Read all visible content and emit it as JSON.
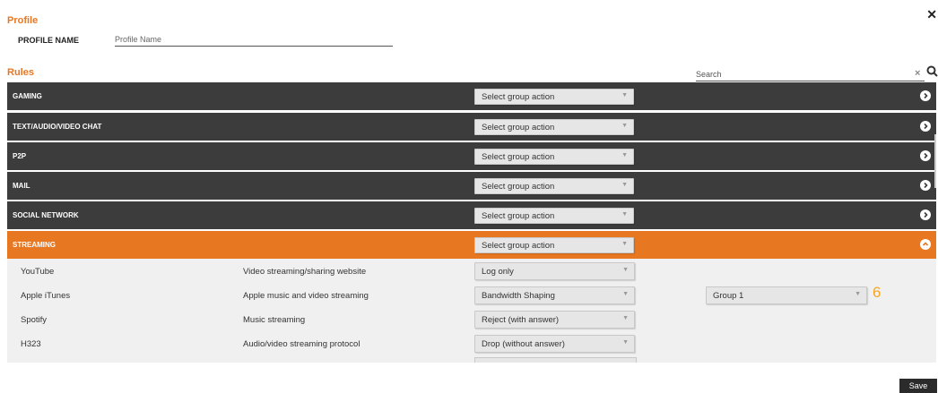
{
  "profile": {
    "title": "Profile",
    "name_label": "PROFILE NAME",
    "name_placeholder": "Profile Name",
    "name_value": ""
  },
  "rules": {
    "title": "Rules",
    "search_placeholder": "Search",
    "search_clear": "×",
    "groups": [
      {
        "name": "GAMING",
        "action": "Select group action",
        "expanded": false
      },
      {
        "name": "TEXT/AUDIO/VIDEO CHAT",
        "action": "Select group action",
        "expanded": false
      },
      {
        "name": "P2P",
        "action": "Select group action",
        "expanded": false
      },
      {
        "name": "MAIL",
        "action": "Select group action",
        "expanded": false
      },
      {
        "name": "SOCIAL NETWORK",
        "action": "Select group action",
        "expanded": false
      },
      {
        "name": "STREAMING",
        "action": "Select group action",
        "expanded": true
      }
    ],
    "apps": [
      {
        "name": "YouTube",
        "description": "Video streaming/sharing website",
        "action": "Log only"
      },
      {
        "name": "Apple iTunes",
        "description": "Apple music and video streaming",
        "action": "Bandwidth Shaping",
        "group": "Group 1",
        "annotation": "6"
      },
      {
        "name": "Spotify",
        "description": "Music streaming",
        "action": "Reject (with answer)"
      },
      {
        "name": "H323",
        "description": "Audio/video streaming protocol",
        "action": "Drop (without answer)"
      }
    ]
  },
  "footer": {
    "save_label": "Save"
  },
  "colors": {
    "accent": "#e87722",
    "group_bar": "#3c3c3c",
    "app_bg": "#f0f0f0",
    "annotation": "#f5a623"
  },
  "icons": {
    "close": "close-icon",
    "search": "search-icon",
    "collapsed": "chevron-right-circle-icon",
    "expanded": "chevron-up-circle-icon",
    "dropdown": "chevron-down-icon"
  }
}
